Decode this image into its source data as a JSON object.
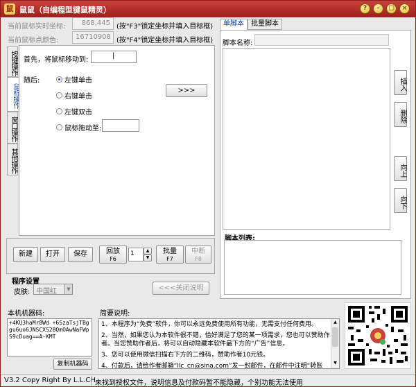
{
  "window": {
    "title": "鼠鼠（自编程型键鼠精灵）",
    "app_icon": "mouse-app-icon",
    "controls": [
      "help-icon",
      "minimize-icon",
      "maximize-icon",
      "close-icon"
    ]
  },
  "header": {
    "coord_label": "当前鼠标实时坐标:",
    "coord_value": "868,445",
    "coord_hint": "(按\"F3\"锁定坐标并填入目标框)",
    "color_label": "当前鼠标点颜色:",
    "color_value": "16710908",
    "color_hint": "(按\"F4\"锁定坐标并填入目标框)"
  },
  "left_tabs": [
    {
      "label": "按键操作",
      "active": false
    },
    {
      "label": "鼠标操作",
      "active": true
    },
    {
      "label": "窗口操作",
      "active": false
    },
    {
      "label": "其他操作",
      "active": false
    }
  ],
  "mouse_panel": {
    "move_label": "首先，将鼠标移动到:",
    "move_value": "|",
    "then_label": "随后:",
    "options": [
      "左键单击",
      "右键单击",
      "左键双击",
      "鼠标拖动至:"
    ],
    "selected_option": 0,
    "insert_arrow": ">>>"
  },
  "toolbar": {
    "new": "新建",
    "open": "打开",
    "save": "保存",
    "replay": "回放",
    "replay_key": "F6",
    "repeat_count": "1",
    "batch": "批量",
    "batch_key": "F7",
    "stop": "中断",
    "stop_key": "F8"
  },
  "settings": {
    "group_label": "程序设置",
    "skin_label": "皮肤:",
    "skin_value": "中国红",
    "close_help": "<<<关闭说明"
  },
  "machine": {
    "label": "本机机器码:",
    "code": "+4KU3haMr8Wd\n+6SzaTsjTBggu6uo6JNSCXS28QmOAwNaFWpS9cDuag==A-KMT",
    "copy_button": "复制机器码"
  },
  "brief": {
    "label": "简要说明:",
    "lines": [
      "1、本程序为“免费”软件，你可以永远免费使用所有功能，无需支付任何费用。",
      "2、当然，如果您认为本软件很不错，恰好满足了您的某一项需求，您也可以赞助作者。当您赞助作者后，将可以自动隐藏本软件最下方的“广告”信息。",
      "3、您可以使用微信扫描右下方的二维码，赞助作者10元钱。",
      "4、付款后，请给作者邮箱“llc_cn@sina.com”发一封邮件，在邮件中注明“转账"
    ]
  },
  "script_panel": {
    "tabs": [
      "单脚本",
      "批量脚本"
    ],
    "active_tab": 0,
    "name_label": "脚本名称:",
    "name_value": "",
    "list_label": "脚本列表:",
    "side_buttons": [
      "插入",
      "删除",
      "向上",
      "向下"
    ]
  },
  "status": {
    "version": "V3.2 Copy Right By L.L.CH.",
    "message": "未找到授权文件，说明信息及付款码暂不能隐藏，个别功能无法使用"
  },
  "colors": {
    "title_red": "#b1302a",
    "accent_blue": "#1a3db0"
  }
}
